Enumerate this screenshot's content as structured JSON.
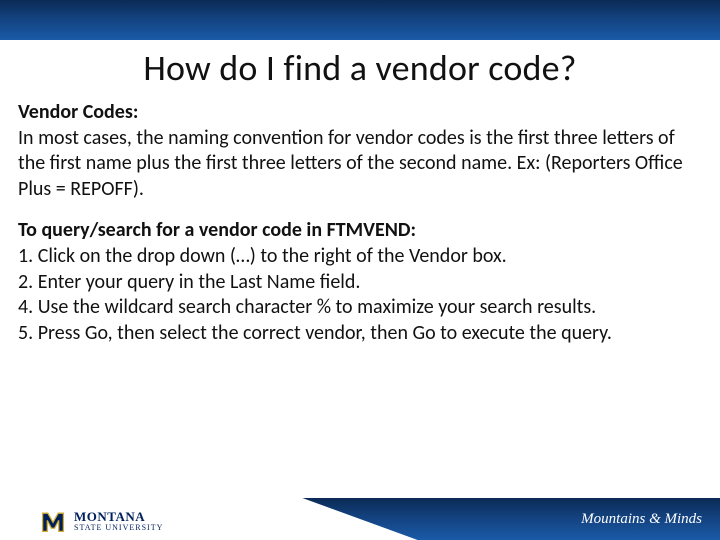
{
  "title": "How do I find a vendor code?",
  "section1": {
    "heading": "Vendor Codes:",
    "text": "In most cases, the naming convention for vendor codes is the first three letters of the first name plus the first three letters of the second name. Ex: (Reporters Office Plus = REPOFF)."
  },
  "section2": {
    "heading": "To query/search for a vendor code in FTMVEND:",
    "step1": "1. Click on the drop down (…) to the right of the Vendor box.",
    "step2": "2. Enter your query in the Last Name field.",
    "step4": "4. Use the wildcard search character % to maximize your search results.",
    "step5": "5. Press Go, then select the correct vendor, then Go to execute the query."
  },
  "footer": {
    "logo_main": "MONTANA",
    "logo_sub": "STATE UNIVERSITY",
    "tagline": "Mountains & Minds"
  }
}
